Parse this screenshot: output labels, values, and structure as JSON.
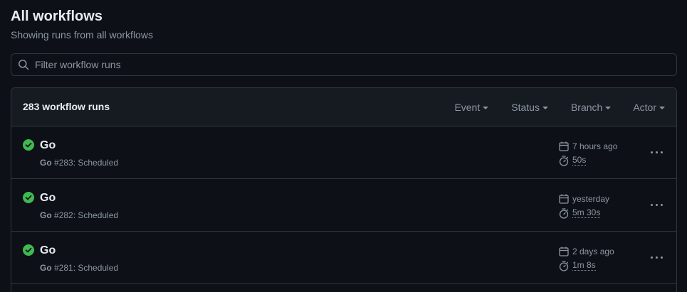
{
  "page": {
    "title": "All workflows",
    "subtitle": "Showing runs from all workflows"
  },
  "filter": {
    "placeholder": "Filter workflow runs",
    "value": ""
  },
  "runs_header": {
    "count_label": "283 workflow runs",
    "menus": {
      "event": "Event",
      "status": "Status",
      "branch": "Branch",
      "actor": "Actor"
    }
  },
  "runs": [
    {
      "status": "success",
      "title": "Go",
      "workflow": "Go",
      "meta": "#283: Scheduled",
      "date": "7 hours ago",
      "duration": "50s"
    },
    {
      "status": "success",
      "title": "Go",
      "workflow": "Go",
      "meta": "#282: Scheduled",
      "date": "yesterday",
      "duration": "5m 30s"
    },
    {
      "status": "success",
      "title": "Go",
      "workflow": "Go",
      "meta": "#281: Scheduled",
      "date": "2 days ago",
      "duration": "1m 8s"
    }
  ],
  "colors": {
    "background": "#0d1117",
    "header_bg": "#161b22",
    "border": "#30363d",
    "text_primary": "#e6edf3",
    "text_muted": "#8d96a0",
    "success": "#3fb950"
  },
  "icons": {
    "search": "search-icon",
    "status": "check-circle-fill-icon",
    "date": "calendar-icon",
    "duration": "stopwatch-icon",
    "more": "kebab-horizontal-icon"
  }
}
